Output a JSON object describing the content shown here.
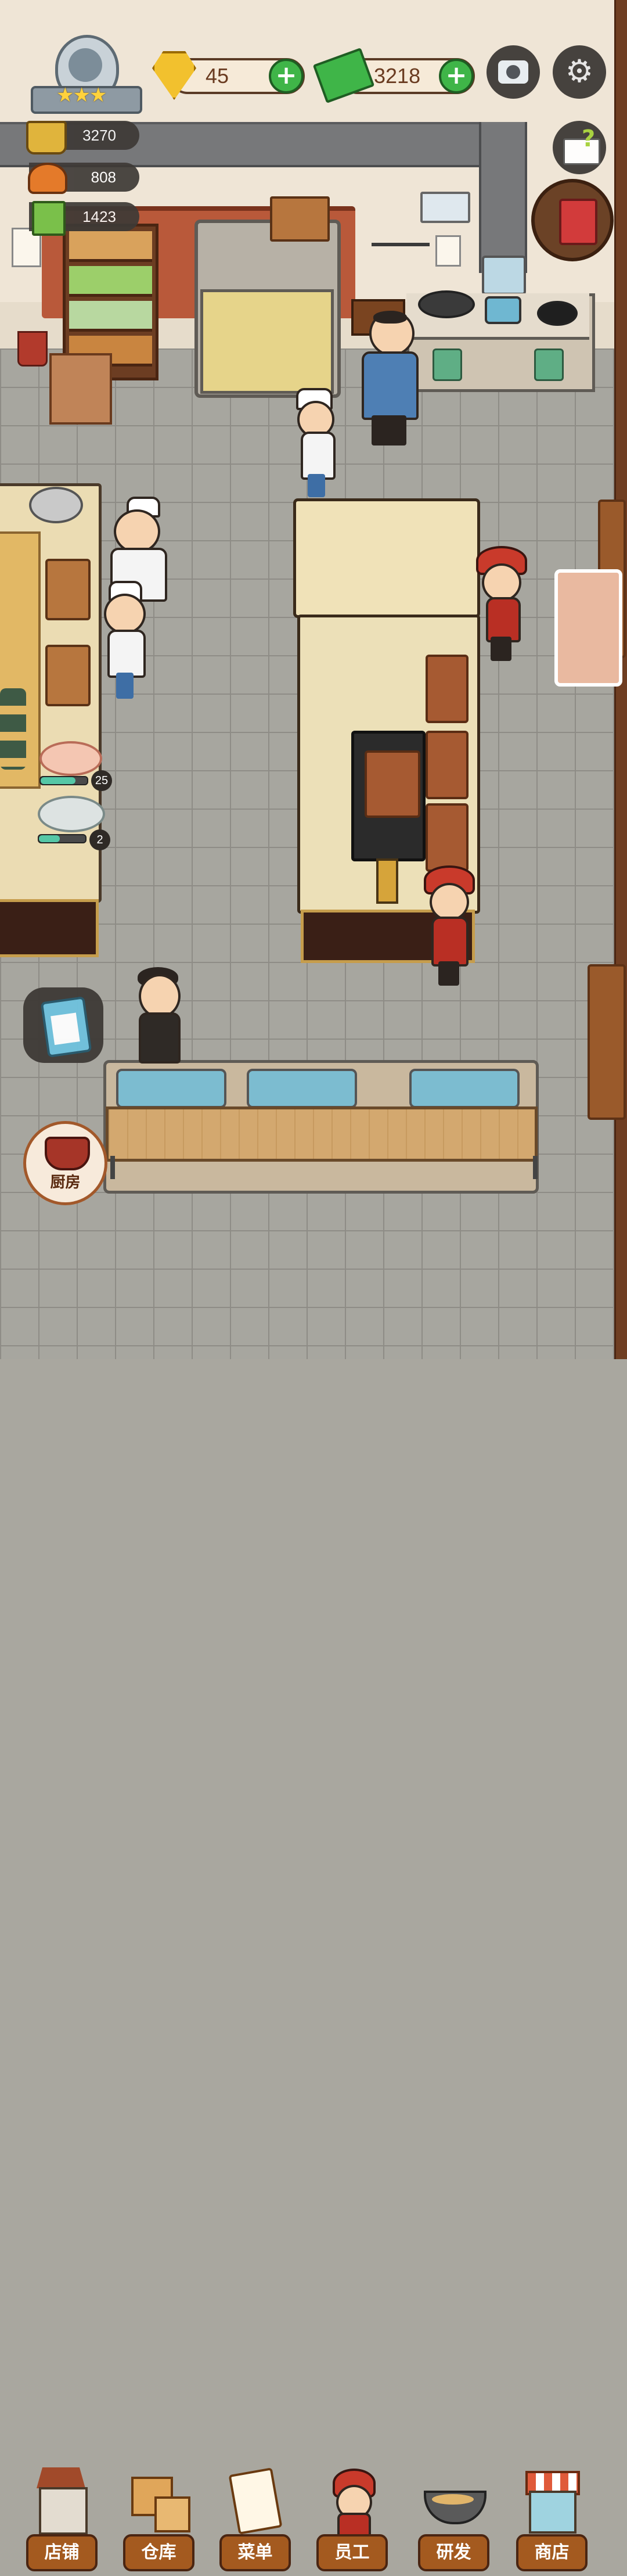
{
  "hud": {
    "rating_stars": 3,
    "gems": {
      "value": "45",
      "icon": "gem-icon",
      "color": "#f2c12e"
    },
    "cash": {
      "value": "3218",
      "icon": "cash-icon",
      "color": "#3fb548"
    },
    "camera_icon": "camera-icon",
    "settings_icon": "gear-icon",
    "help_icon": "help-book-icon",
    "recipe_book_icon": "recipe-book-icon"
  },
  "resources": [
    {
      "name": "hotpot",
      "icon": "hotpot-icon",
      "value": "3270"
    },
    {
      "name": "dish",
      "icon": "serving-dish-icon",
      "value": "808"
    },
    {
      "name": "menu",
      "icon": "menu-book-icon",
      "value": "1423"
    }
  ],
  "prep_station": {
    "items": [
      {
        "name": "meat-platter",
        "count": "25",
        "progress": 0.75
      },
      {
        "name": "oyster-platter",
        "count": "2",
        "progress": 0.45
      }
    ]
  },
  "kitchen_button": {
    "label": "厨房",
    "icon": "kitchen-pot-icon"
  },
  "task_button": {
    "icon": "clipboard-icon"
  },
  "nav": [
    {
      "id": "store",
      "label": "店铺",
      "icon": "shop-building-icon"
    },
    {
      "id": "warehouse",
      "label": "仓库",
      "icon": "boxes-icon"
    },
    {
      "id": "menu",
      "label": "菜单",
      "icon": "clipboard-menu-icon"
    },
    {
      "id": "staff",
      "label": "员工",
      "icon": "staff-icon"
    },
    {
      "id": "research",
      "label": "研发",
      "icon": "wok-icon"
    },
    {
      "id": "shop",
      "label": "商店",
      "icon": "storefront-icon"
    }
  ],
  "colors": {
    "accent_green": "#3fb548",
    "label_brown": "#a45a1f",
    "wall": "#efe5d6",
    "floor": "#a7a69f"
  }
}
